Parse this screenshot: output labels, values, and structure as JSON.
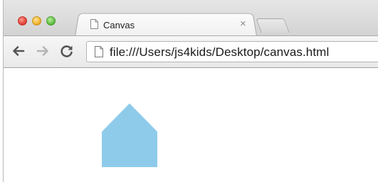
{
  "tab": {
    "title": "Canvas",
    "close_glyph": "×",
    "icon": "document-icon"
  },
  "toolbar": {
    "back_icon": "arrow-left-icon",
    "forward_icon": "arrow-right-icon",
    "reload_icon": "reload-icon"
  },
  "address_bar": {
    "url": "file:///Users/js4kids/Desktop/canvas.html",
    "icon": "page-icon"
  },
  "canvas": {
    "shape": "house",
    "fill_color": "#8ecbea"
  },
  "colors": {
    "traffic_red": "#e2443a",
    "traffic_yellow": "#f0b52e",
    "traffic_green": "#63c147"
  }
}
